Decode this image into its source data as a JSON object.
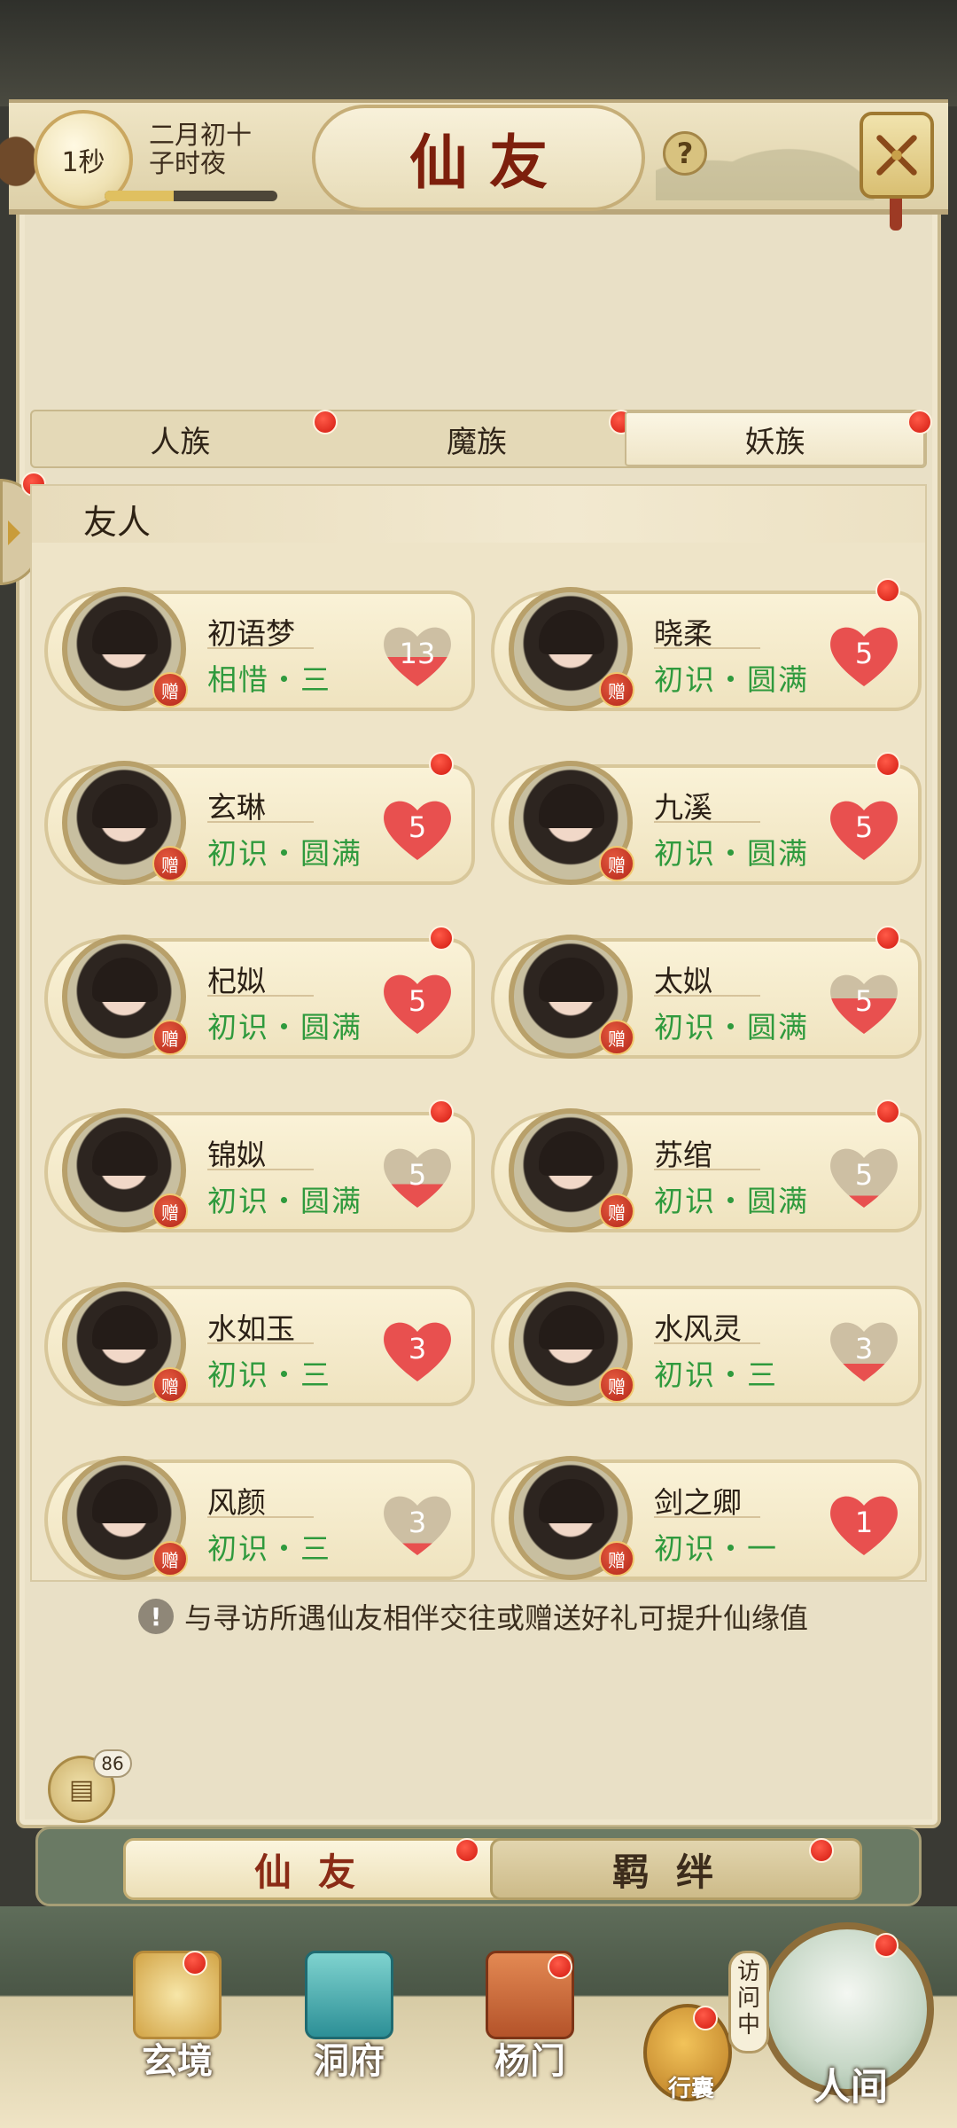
{
  "header": {
    "timer": "1秒",
    "date_line1": "二月初十",
    "date_line2": "子时夜",
    "title": "仙友",
    "help": "?"
  },
  "race_tabs": [
    "人族",
    "魔族",
    "妖族"
  ],
  "section_title": "友人",
  "friends": [
    {
      "name": "初语梦",
      "status": "相惜・三",
      "hearts": "13",
      "gift": "赠"
    },
    {
      "name": "晓柔",
      "status": "初识・圆满",
      "hearts": "5",
      "gift": "赠"
    },
    {
      "name": "玄琳",
      "status": "初识・圆满",
      "hearts": "5",
      "gift": "赠"
    },
    {
      "name": "九溪",
      "status": "初识・圆满",
      "hearts": "5",
      "gift": "赠"
    },
    {
      "name": "杞姒",
      "status": "初识・圆满",
      "hearts": "5",
      "gift": "赠"
    },
    {
      "name": "太姒",
      "status": "初识・圆满",
      "hearts": "5",
      "gift": "赠"
    },
    {
      "name": "锦姒",
      "status": "初识・圆满",
      "hearts": "5",
      "gift": "赠"
    },
    {
      "name": "苏绾",
      "status": "初识・圆满",
      "hearts": "5",
      "gift": "赠"
    },
    {
      "name": "水如玉",
      "status": "初识・三",
      "hearts": "3",
      "gift": "赠"
    },
    {
      "name": "水风灵",
      "status": "初识・三",
      "hearts": "3",
      "gift": "赠"
    },
    {
      "name": "风颜",
      "status": "初识・三",
      "hearts": "3",
      "gift": "赠"
    },
    {
      "name": "剑之卿",
      "status": "初识・一",
      "hearts": "1",
      "gift": "赠"
    }
  ],
  "tip": "与寻访所遇仙友相伴交往或赠送好礼可提升仙缘值",
  "chat_count": "86",
  "bottom_tabs": [
    "仙友",
    "羁绊"
  ],
  "nav": {
    "items": [
      "玄境",
      "洞府",
      "杨门"
    ],
    "bag": "行囊",
    "visiting": "访问中",
    "world": "人间"
  },
  "colors": {
    "status_green": "#2f9a3d",
    "title_red": "#7d1f0c",
    "dot_red": "#d21a10"
  }
}
